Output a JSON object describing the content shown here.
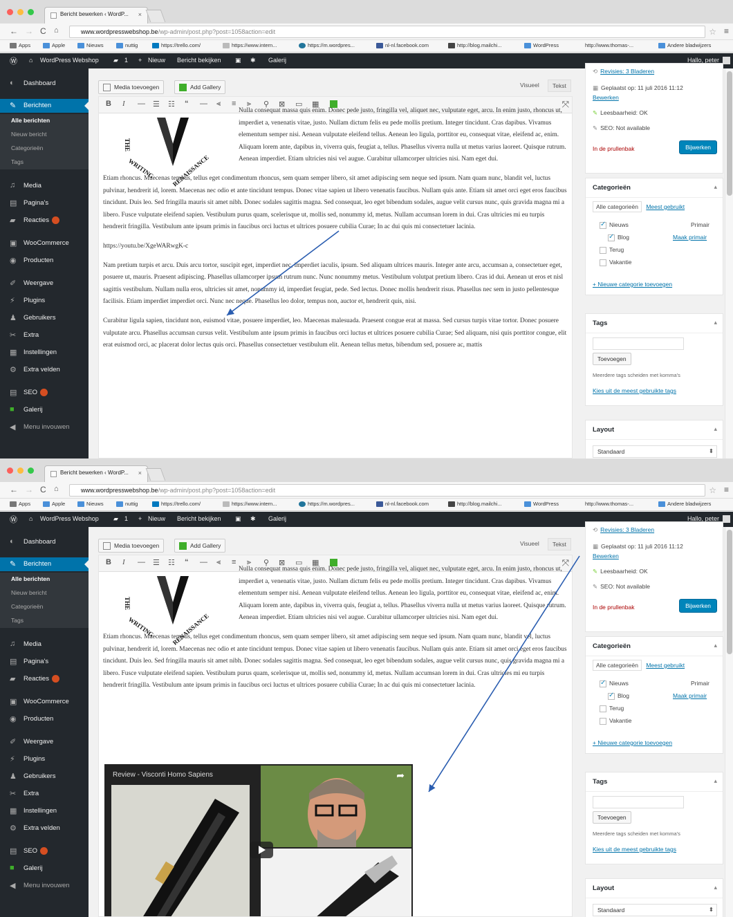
{
  "browser": {
    "tab_title": "Bericht bewerken ‹ WordP...",
    "url_domain": "www.wordpresswebshop.be",
    "url_path": "/wp-admin/post.php?post=1058action=edit",
    "bookmarks": [
      "Apps",
      "Apple",
      "Nieuws",
      "nuttig",
      "https://trello.com/",
      "https://www.intern...",
      "https://m.wordpres...",
      "nl-nl.facebook.com",
      "http://blog.mailchi...",
      "WordPress",
      "http://www.thomas-...",
      "Andere bladwijzers"
    ]
  },
  "adminbar": {
    "site": "WordPress Webshop",
    "comments": "1",
    "new": "Nieuw",
    "view": "Bericht bekijken",
    "gallery": "Galerij",
    "greeting": "Hallo, peter"
  },
  "sidebar": {
    "dashboard": "Dashboard",
    "berichten": "Berichten",
    "sub": [
      "Alle berichten",
      "Nieuw bericht",
      "Categorieën",
      "Tags"
    ],
    "media": "Media",
    "paginas": "Pagina's",
    "reacties": "Reacties",
    "woocommerce": "WooCommerce",
    "producten": "Producten",
    "weergave": "Weergave",
    "plugins": "Plugins",
    "gebruikers": "Gebruikers",
    "extra": "Extra",
    "instellingen": "Instellingen",
    "extra_velden": "Extra velden",
    "seo": "SEO",
    "galerij": "Galerij",
    "menu_invouwen": "Menu invouwen"
  },
  "editor": {
    "media_button": "Media toevoegen",
    "gallery_button": "Add Gallery",
    "tab_visual": "Visueel",
    "tab_text": "Tekst",
    "para1": "Nulla consequat massa quis enim. Donec pede justo, fringilla vel, aliquet nec, vulputate eget, arcu. In enim justo, rhoncus ut, imperdiet a, venenatis vitae, justo. Nullam dictum felis eu pede mollis pretium. Integer tincidunt. Cras dapibus. Vivamus elementum semper nisi. Aenean vulputate eleifend tellus. Aenean leo ligula, porttitor eu, consequat vitae, eleifend ac, enim. Aliquam lorem ante, dapibus in, viverra quis, feugiat a, tellus. Phasellus viverra nulla ut metus varius laoreet. Quisque rutrum. Aenean imperdiet. Etiam ultricies nisi vel augue. Curabitur ullamcorper ultricies nisi. Nam eget dui.",
    "para2": "Etiam rhoncus. Maecenas tempus, tellus eget condimentum rhoncus, sem quam semper libero, sit amet adipiscing sem neque sed ipsum. Nam quam nunc, blandit vel, luctus pulvinar, hendrerit id, lorem. Maecenas nec odio et ante tincidunt tempus. Donec vitae sapien ut libero venenatis faucibus. Nullam quis ante. Etiam sit amet orci eget eros faucibus tincidunt. Duis leo. Sed fringilla mauris sit amet nibh. Donec sodales sagittis magna. Sed consequat, leo eget bibendum sodales, augue velit cursus nunc, quis gravida magna mi a libero. Fusce vulputate eleifend sapien. Vestibulum purus quam, scelerisque ut, mollis sed, nonummy id, metus. Nullam accumsan lorem in dui. Cras ultricies mi eu turpis hendrerit fringilla. Vestibulum ante ipsum primis in faucibus orci luctus et ultrices posuere cubilia Curae; In ac dui quis mi consectetuer lacinia.",
    "youtube_url": "https://youtu.be/XgeWARwgK-c",
    "para3": "Nam pretium turpis et arcu. Duis arcu tortor, suscipit eget, imperdiet nec, imperdiet iaculis, ipsum. Sed aliquam ultrices mauris. Integer ante arcu, accumsan a, consectetuer eget, posuere ut, mauris. Praesent adipiscing. Phasellus ullamcorper ipsum rutrum nunc. Nunc nonummy metus. Vestibulum volutpat pretium libero. Cras id dui. Aenean ut eros et nisl sagittis vestibulum. Nullam nulla eros, ultricies sit amet, nonummy id, imperdiet feugiat, pede. Sed lectus. Donec mollis hendrerit risus. Phasellus nec sem in justo pellentesque facilisis. Etiam imperdiet imperdiet orci. Nunc nec neque. Phasellus leo dolor, tempus non, auctor et, hendrerit quis, nisi.",
    "para4": "Curabitur ligula sapien, tincidunt non, euismod vitae, posuere imperdiet, leo. Maecenas malesuada. Praesent congue erat at massa. Sed cursus turpis vitae tortor. Donec posuere vulputate arcu. Phasellus accumsan cursus velit. Vestibulum ante ipsum primis in faucibus orci luctus et ultrices posuere cubilia Curae; Sed aliquam, nisi quis porttitor congue, elit erat euismod orci, ac placerat dolor lectus quis orci. Phasellus consectetuer vestibulum elit. Aenean tellus metus, bibendum sed, posuere ac, mattis",
    "video_title": "Review - Visconti Homo Sapiens",
    "logo_text": "THE WRITING RENAISSANCE"
  },
  "publish": {
    "revisions": "Revisies: 3 Bladeren",
    "scheduled": "Geplaatst op: 11 juli 2016 11:12",
    "edit": "Bewerken",
    "readability": "Leesbaarheid: OK",
    "seo": "SEO: Not available",
    "trash": "In de prullenbak",
    "update": "Bijwerken"
  },
  "categories": {
    "title": "Categorieën",
    "tab_all": "Alle categorieën",
    "tab_used": "Meest gebruikt",
    "items": [
      {
        "label": "Nieuws",
        "checked": true,
        "extra": "Primair"
      },
      {
        "label": "Blog",
        "checked": true,
        "extra": "Maak primair"
      },
      {
        "label": "Terug",
        "checked": false,
        "extra": ""
      },
      {
        "label": "Vakantie",
        "checked": false,
        "extra": ""
      }
    ],
    "add_new": "+ Nieuwe categorie toevoegen"
  },
  "tags": {
    "title": "Tags",
    "add": "Toevoegen",
    "hint": "Meerdere tags scheiden met komma's",
    "choose": "Kies uit de meest gebruikte tags"
  },
  "layout": {
    "title": "Layout",
    "value": "Standaard"
  },
  "colors": {
    "wp_dark": "#23282d",
    "wp_blue": "#0073aa",
    "arrow": "#2a5db0"
  }
}
